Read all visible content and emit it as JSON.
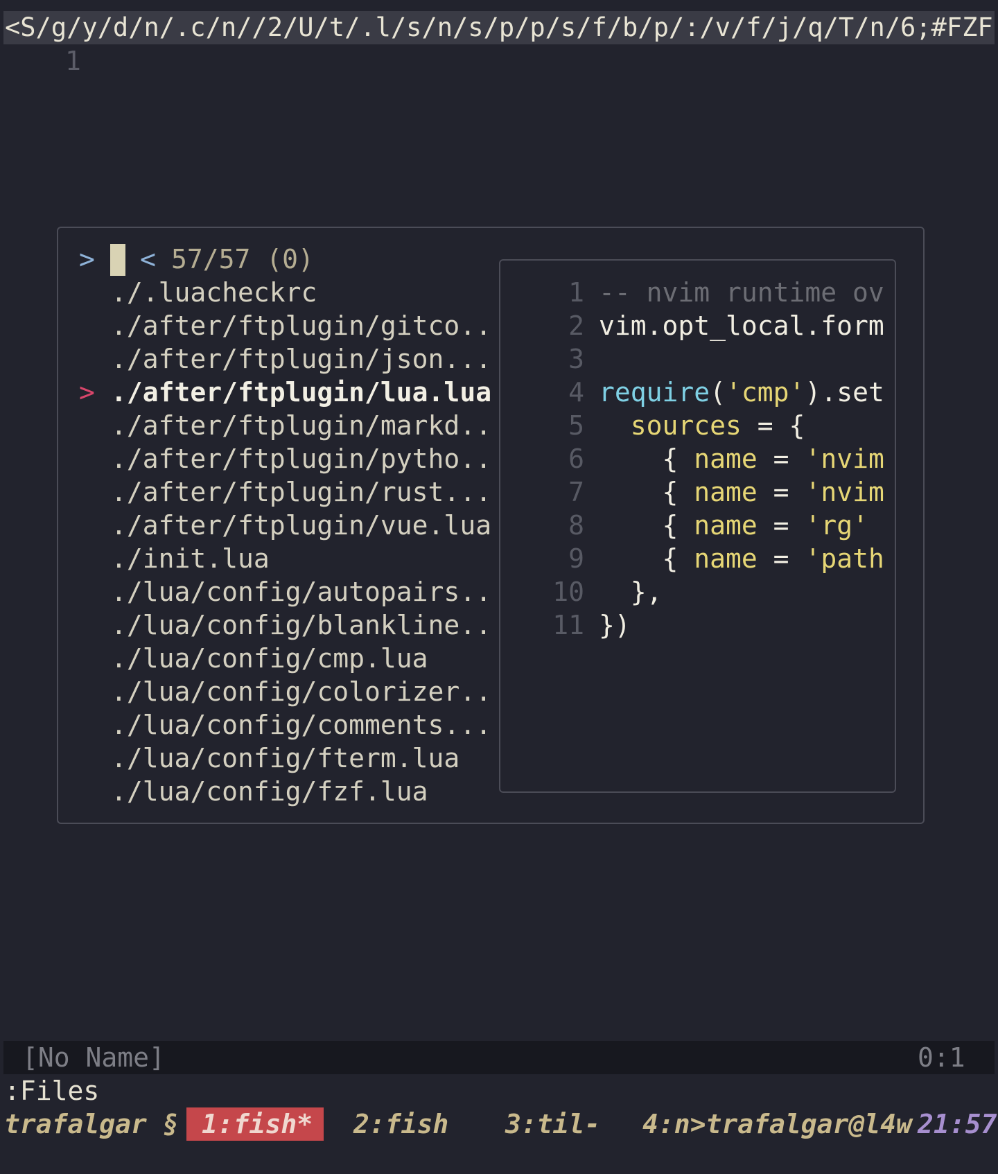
{
  "tabline": {
    "title": "<S/g/y/d/n/.c/n//2/U/t/.l/s/n/s/p/p/s/f/b/p/:/v/f/j/q/T/n/6;#FZF"
  },
  "buffer": {
    "line_number": "1"
  },
  "fzf": {
    "prompt": ">",
    "back_marker": "<",
    "count": "57/57 (0)",
    "selected_marker": ">",
    "files": [
      "./.luacheckrc",
      "./after/ftplugin/gitco..",
      "./after/ftplugin/json...",
      "./after/ftplugin/lua.lua",
      "./after/ftplugin/markd..",
      "./after/ftplugin/pytho..",
      "./after/ftplugin/rust...",
      "./after/ftplugin/vue.lua",
      "./init.lua",
      "./lua/config/autopairs..",
      "./lua/config/blankline..",
      "./lua/config/cmp.lua",
      "./lua/config/colorizer..",
      "./lua/config/comments...",
      "./lua/config/fterm.lua",
      "./lua/config/fzf.lua"
    ],
    "preview": {
      "line_numbers": [
        "1",
        "2",
        "3",
        "4",
        "5",
        "6",
        "7",
        "8",
        "9",
        "10",
        "11"
      ],
      "l1": "-- nvim runtime ov",
      "l2": "vim.opt_local.form",
      "l4_fn": "require",
      "l4_p1": "(",
      "l4_str": "'cmp'",
      "l4_rest": ").set",
      "l5_key": "  sources",
      "l5_rest": " = {",
      "l6_pre": "    { ",
      "l6_key": "name",
      "l6_eq": " = ",
      "l6_str": "'nvim",
      "l7_str": "'nvim",
      "l8_str": "'rg'",
      "l9_str": "'path",
      "l10": "  },",
      "l11": "})"
    }
  },
  "statusline": {
    "name": "[No Name]",
    "position": "0:1"
  },
  "cmdline": {
    "text": ":Files"
  },
  "tmux": {
    "session": "trafalgar §",
    "window1": "1:fish*",
    "window2": "2:fish",
    "window3": "3:til-",
    "window4": "4:n>trafalgar@l4w",
    "time": "21:57"
  },
  "colors": {
    "background": "#22232d",
    "selection_marker": "#d9466b",
    "prompt": "#8fb3d9",
    "active_window": "#c5474b",
    "string": "#e6d675",
    "function": "#7fd0e4"
  }
}
